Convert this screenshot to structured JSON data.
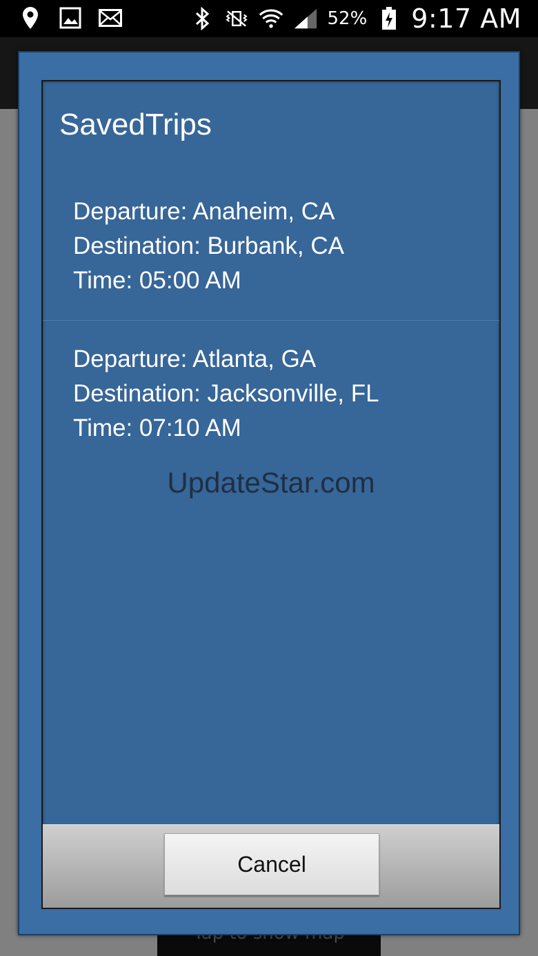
{
  "status_bar": {
    "left_icons": [
      "location-icon",
      "image-icon",
      "mail-icon"
    ],
    "right_icons": [
      "bluetooth-icon",
      "vibrate-icon",
      "wifi-icon",
      "signal-icon"
    ],
    "battery": "52%",
    "time": "9:17 AM"
  },
  "background": {
    "bottom_button_label": "Tap to show map"
  },
  "dialog": {
    "title": "SavedTrips",
    "trips": [
      {
        "departure": "Departure: Anaheim, CA",
        "destination": "Destination: Burbank, CA",
        "time": "Time: 05:00 AM"
      },
      {
        "departure": "Departure: Atlanta, GA",
        "destination": "Destination: Jacksonville, FL",
        "time": "Time: 07:10 AM"
      }
    ],
    "watermark": "UpdateStar.com",
    "cancel_label": "Cancel"
  },
  "colors": {
    "dialog_background": "#376698",
    "dialog_frame": "#3a6ea5"
  }
}
